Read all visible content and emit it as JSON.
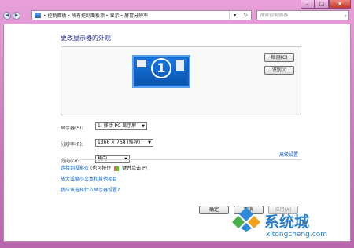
{
  "window": {
    "minimize_label": "–",
    "maximize_label": "□",
    "close_label": "x"
  },
  "toolbar": {
    "back_label": "◀",
    "forward_label": "▶",
    "breadcrumbs": [
      "控制面板",
      "所有控制面板项",
      "显示",
      "屏幕分辨率"
    ],
    "search_placeholder": "搜索控制面板",
    "refresh_label": "↻"
  },
  "main": {
    "title": "更改显示器的外观",
    "monitor_number": "1",
    "detect_button": "检测(C)",
    "identify_button": "识别(I)",
    "display_label": "显示器(S):",
    "display_value": "1. 移动 PC 显示屏",
    "resolution_label": "分辨率(R):",
    "resolution_value": "1366 × 768 (推荐)",
    "orientation_label": "方向(O):",
    "orientation_value": "横向",
    "advanced_link": "高级设置",
    "projector_link": "连接到投影仪",
    "projector_hint_1": "(也可按住",
    "projector_hint_2": "键并点击 P)",
    "text_size_link": "放大或缩小文本和其他项目",
    "help_link": "我应该选择什么显示器设置?",
    "ok_button": "确定",
    "cancel_button": "取消",
    "apply_button": "应用(A)"
  },
  "watermark": {
    "brand": "系统城",
    "url": "xitongcheng.com"
  }
}
